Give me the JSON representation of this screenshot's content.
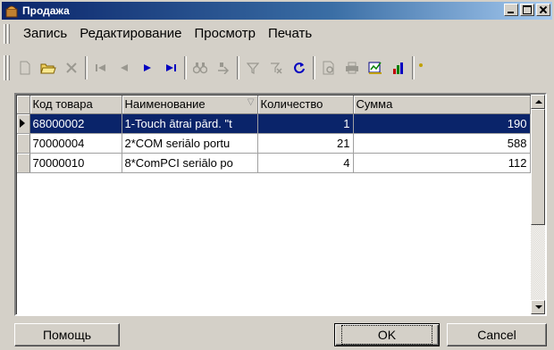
{
  "window": {
    "title": "Продажа"
  },
  "menu": [
    "Запись",
    "Редактирование",
    "Просмотр",
    "Печать"
  ],
  "toolbar": {
    "new_icon": "new-document-icon",
    "open_icon": "open-folder-icon",
    "delete_icon": "delete-x-icon",
    "first_icon": "first-record-icon",
    "prev_icon": "prev-record-icon",
    "next_icon": "next-record-icon",
    "last_icon": "last-record-icon",
    "find_icon": "binoculars-icon",
    "findnext_icon": "find-next-icon",
    "filter_icon": "filter-icon",
    "clearfilter_icon": "clear-filter-icon",
    "refresh_icon": "refresh-icon",
    "preview_icon": "print-preview-icon",
    "print_icon": "printer-icon",
    "report_icon": "report-icon",
    "chart_icon": "chart-icon"
  },
  "grid": {
    "columns": [
      "Код товара",
      "Наименование",
      "Количество",
      "Сумма"
    ],
    "rows": [
      {
        "code": "68000002",
        "name": "1-Touch ātrai pārd. \"t",
        "qty": "1",
        "sum": "190"
      },
      {
        "code": "70000004",
        "name": "2*COM seriālo portu",
        "qty": "21",
        "sum": "588"
      },
      {
        "code": "70000010",
        "name": "8*ComPCI seriālo po",
        "qty": "4",
        "sum": "112"
      }
    ]
  },
  "buttons": {
    "help": "Помощь",
    "ok": "OK",
    "cancel": "Cancel"
  },
  "colors": {
    "selection": "#0a246a",
    "title_start": "#0a246a",
    "face": "#d4d0c8"
  }
}
